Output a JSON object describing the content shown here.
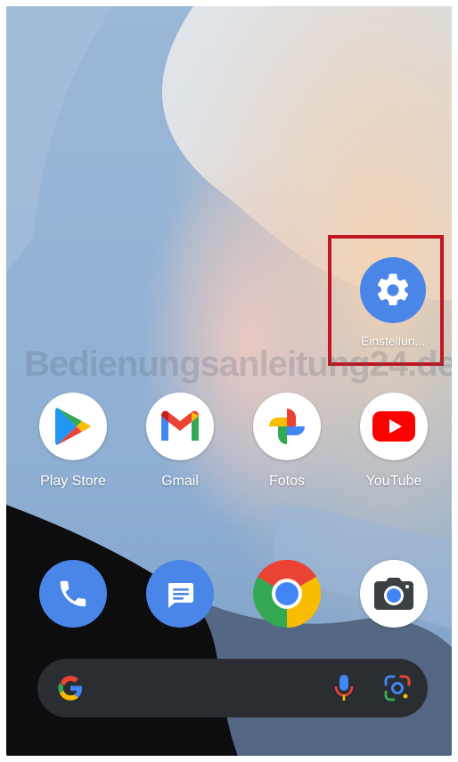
{
  "settings_app": {
    "label": "Einstellun...",
    "icon": "gear-icon"
  },
  "watermark": {
    "text": "Bedienungsanleitung24.de"
  },
  "app_row": [
    {
      "label": "Play Store",
      "icon": "play-store-icon"
    },
    {
      "label": "Gmail",
      "icon": "gmail-icon"
    },
    {
      "label": "Fotos",
      "icon": "photos-icon"
    },
    {
      "label": "YouTube",
      "icon": "youtube-icon"
    }
  ],
  "dock": [
    {
      "name": "phone",
      "icon": "phone-icon"
    },
    {
      "name": "messages",
      "icon": "messages-icon"
    },
    {
      "name": "chrome",
      "icon": "chrome-icon"
    },
    {
      "name": "camera",
      "icon": "camera-icon"
    }
  ],
  "search_bar": {
    "logo": "google-g-icon",
    "voice": "microphone-icon",
    "lens": "lens-icon"
  },
  "colors": {
    "highlight": "#c01722",
    "settings_blue": "#4a86e8",
    "search_bg": "#2a2d31"
  }
}
